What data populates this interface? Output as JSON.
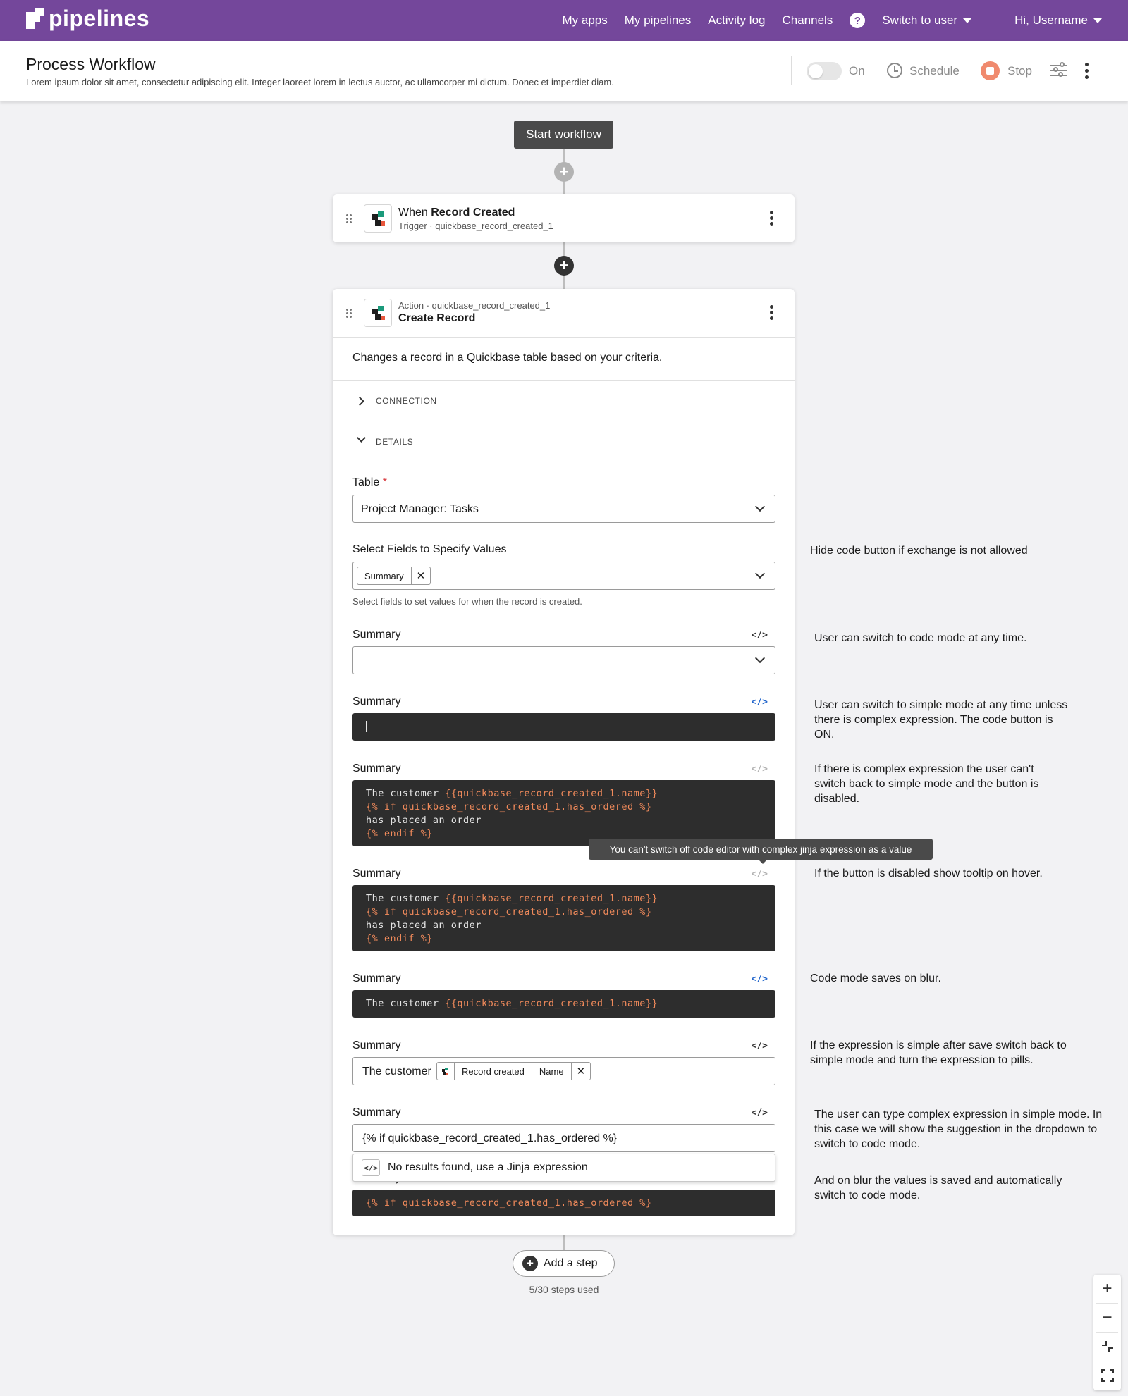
{
  "nav": {
    "brand": "pipelines",
    "links": [
      "My apps",
      "My pipelines",
      "Activity log",
      "Channels"
    ],
    "help": "?",
    "switch_user": "Switch to user",
    "greeting": "Hi, Username"
  },
  "header": {
    "title": "Process Workflow",
    "description": "Lorem ipsum dolor sit amet, consectetur adipiscing elit. Integer laoreet lorem in lectus auctor, ac ullamcorper mi dictum. Donec et imperdiet diam.",
    "toggle_label": "On",
    "toggle_on": false,
    "schedule": "Schedule",
    "stop": "Stop"
  },
  "canvas": {
    "start": "Start workflow",
    "trigger": {
      "prefix": "When ",
      "name": "Record Created",
      "subtitle": "Trigger · quickbase_record_created_1"
    },
    "action": {
      "subtitle": "Action · quickbase_record_created_1",
      "name": "Create Record",
      "description": "Changes a record in a Quickbase table based on your criteria.",
      "connection_label": "CONNECTION",
      "details_label": "DETAILS",
      "table_label": "Table",
      "required_mark": "*",
      "table_value": "Project Manager: Tasks",
      "fields_label": "Select Fields to Specify Values",
      "fields_chip": "Summary",
      "fields_help": "Select fields to set values for when the record is created.",
      "code_icon": "</>",
      "summary_label": "Summary",
      "code_plain": "The customer ",
      "code_var_name": "{{quickbase_record_created_1.name}}",
      "code_if": "{% if quickbase_record_created_1.has_ordered %}",
      "code_placed": "has placed an order",
      "code_endif": "{% endif %}",
      "tooltip": "You can't switch off code editor with complex jinja expression as a value",
      "pill_prefix": "The customer",
      "pill_source": "Record created",
      "pill_field": "Name",
      "simple_input_value": "{% if quickbase_record_created_1.has_ordered %}",
      "suggestion": "No results found, use a Jinja expression"
    },
    "add_step": "Add a step",
    "steps_used": "5/30 steps used"
  },
  "notes": [
    "Hide code button if exchange is not allowed",
    "User can switch to code mode at any time.",
    "User can switch to simple mode at any time unless there is complex expression. The code button is ON.",
    "If there is complex expression the user can't switch back to simple mode and the button is disabled.",
    "If the button is disabled show tooltip on hover.",
    "Code mode saves on blur.",
    "If the expression is simple after save switch back to simple mode and turn the expression to pills.",
    "The user can type complex expression in simple mode. In this case we will show the suggestion in the dropdown to switch to code mode.",
    "And on blur the values is saved and automatically switch to code mode."
  ],
  "zoom": {
    "in": "+",
    "out": "−"
  },
  "colors": {
    "nav_bg": "#74479b",
    "code_bg": "#2d2d2d",
    "code_token": "#f08a5b",
    "code_toggle_on": "#2266cc",
    "stop": "#f08a6e"
  },
  "icons": [
    "pipelines-logo-icon",
    "help-icon",
    "chevron-down-icon",
    "clock-icon",
    "stop-icon",
    "sliders-icon",
    "more-vertical-icon",
    "drag-handle-icon",
    "quickbase-icon",
    "plus-icon",
    "chevron-right-icon",
    "close-icon",
    "code-icon",
    "zoom-in-icon",
    "zoom-out-icon",
    "fit-icon",
    "fullscreen-icon"
  ]
}
